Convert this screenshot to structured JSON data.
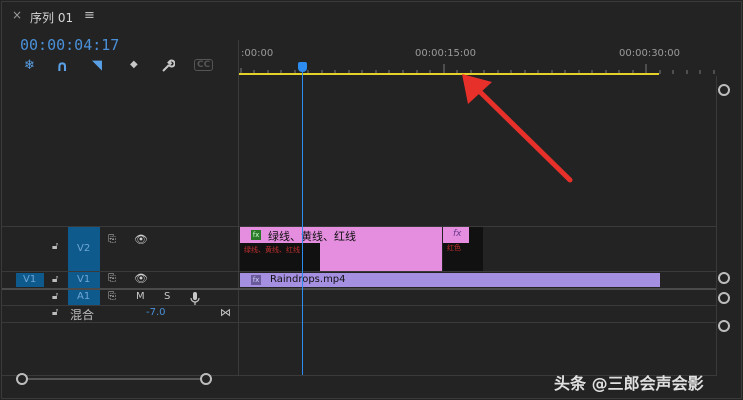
{
  "tab": {
    "close_glyph": "×",
    "title": "序列 01",
    "menu_glyph": "≡"
  },
  "timecode": "00:00:04:17",
  "toolbar": [
    {
      "name": "snap-icon",
      "glyph": "❄"
    },
    {
      "name": "linked-selection-icon",
      "glyph": "∩"
    },
    {
      "name": "add-marker-icon",
      "glyph": "◥"
    },
    {
      "name": "marker-icon",
      "glyph": "◆"
    },
    {
      "name": "wrench-icon",
      "glyph": "🔧"
    },
    {
      "name": "captions-icon",
      "glyph": "CC"
    }
  ],
  "ruler": {
    "labels": [
      ":00:00",
      "00:00:15:00",
      "00:00:30:00"
    ]
  },
  "tracks": {
    "v2": {
      "label": "V2"
    },
    "v1": {
      "source_label": "V1",
      "label": "V1"
    },
    "a1": {
      "label": "A1",
      "mute": "M",
      "solo": "S"
    },
    "mix": {
      "label": "混合",
      "value": "-7.0"
    }
  },
  "clips": {
    "v2_main_label": "绿线、黄线、红线",
    "v2_main_fx": "fx",
    "v2_main_sub": "绿线、黄线、红线",
    "v2_small_fx": "fx",
    "v2_small_sub": "红色",
    "v1_fx": "fx",
    "v1_label": "Raindrops.mp4"
  },
  "watermark": "头条 @三郎会声会影",
  "colors": {
    "timecode": "#4a90d9",
    "playhead": "#2d8cf0",
    "work_area": "#e6d12a",
    "v2_clip": "#e58ee0",
    "v1_clip": "#a58fe0",
    "track_target": "#0f5a8c",
    "arrow": "#e8302a"
  }
}
